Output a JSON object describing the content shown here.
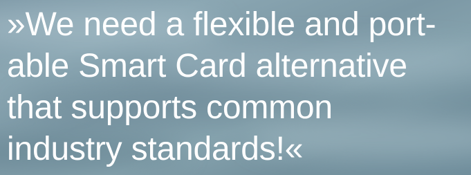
{
  "quote": {
    "lines": [
      "»We need a flexible and port-",
      "able Smart Card alternative",
      "that supports common",
      "industry standards!«"
    ]
  },
  "colors": {
    "background": "#7f9aa8",
    "text": "#ffffff"
  }
}
